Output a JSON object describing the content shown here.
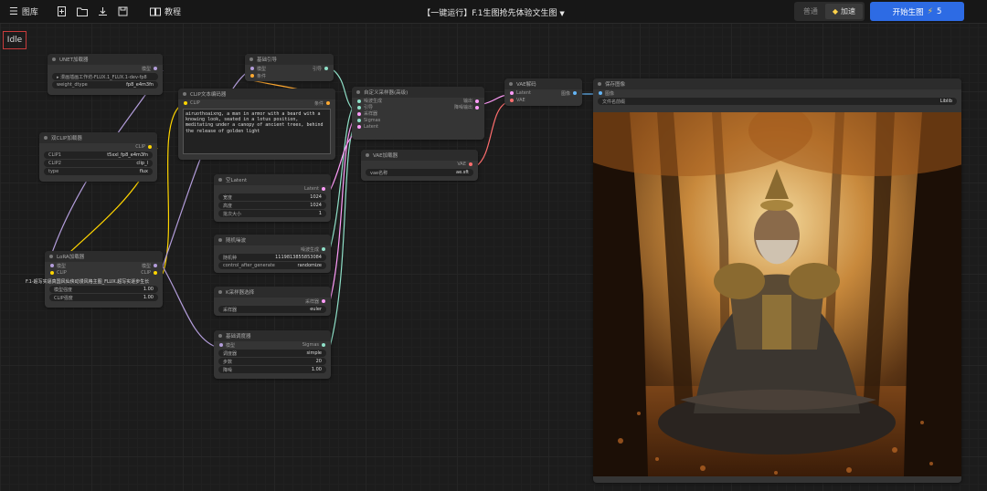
{
  "topbar": {
    "gallery_label": "图库",
    "tutorial_label": "教程",
    "workflow_title": "【一键运行】F.1生图抢先体验文生图",
    "mode_normal": "普通",
    "mode_boost": "加速",
    "run_label": "开始生图",
    "run_cost": "5"
  },
  "status": "Idle",
  "nodes": {
    "unet": {
      "title": "UNET加载器",
      "out_model": "模型",
      "w1_label": "▸ 漫画插画工作坊-FLUX.1_FLUX.1-dev-fp8",
      "w2_label": "weight_dtype",
      "w2_value": "fp8_e4m3fn"
    },
    "dualclip": {
      "title": "双CLIP加载器",
      "out_clip": "CLIP",
      "w1_label": "CLIP1",
      "w1_value": "t5xxl_fp8_e4m3fn",
      "w2_label": "CLIP2",
      "w2_value": "clip_l",
      "w3_label": "type",
      "w3_value": "flux"
    },
    "lora": {
      "title": "LoRA加载器",
      "in_model": "模型",
      "in_clip": "CLIP",
      "out_model": "模型",
      "out_clip": "CLIP",
      "w1_value": "F.1-超写实逼真国风仙侠动漫风格主图_FLUX.超写实逐步生长-V1",
      "w2_label": "模型强度",
      "w2_value": "1.00",
      "w3_label": "CLIP强度",
      "w3_value": "1.00"
    },
    "guider": {
      "title": "基础引导",
      "in_model": "模型",
      "in_cond": "条件",
      "out_guider": "引导"
    },
    "clip_text": {
      "title": "CLIP文本编码器",
      "in_clip": "CLIP",
      "out_cond": "条件",
      "text": "airuothoaixng, a man in armor with a beard with a knowing look, seated in a lotus position, meditating under a canopy of ancient trees, behind the release of golden light"
    },
    "sampler_adv": {
      "title": "自定义采样器(高级)",
      "in1": "噪波生成",
      "in2": "引导",
      "in3": "采样器",
      "in4": "Sigmas",
      "in5": "Latent",
      "out1": "输出",
      "out2": "降噪输出"
    },
    "vae_decode": {
      "title": "VAE解码",
      "in1": "Latent",
      "in2": "VAE",
      "out1": "图像"
    },
    "vae_loader": {
      "title": "VAE加载器",
      "out": "VAE",
      "w1_label": "vae名称",
      "w1_value": "ae.sft"
    },
    "empty_latent": {
      "title": "空Latent",
      "out": "Latent",
      "w1_label": "宽度",
      "w1_value": "1024",
      "w2_label": "高度",
      "w2_value": "1024",
      "w3_label": "批次大小",
      "w3_value": "1"
    },
    "noise": {
      "title": "随机噪波",
      "out": "噪波生成",
      "w1_label": "随机种",
      "w1_value": "1119813855853084",
      "w2_label": "control_after_generate",
      "w2_value": "randomize"
    },
    "ksampler_select": {
      "title": "K采样器选择",
      "out": "采样器",
      "w1_label": "采样器",
      "w1_value": "euler"
    },
    "scheduler": {
      "title": "基础调度器",
      "in_model": "模型",
      "out": "Sigmas",
      "w1_label": "调度器",
      "w1_value": "simple",
      "w2_label": "步数",
      "w2_value": "20",
      "w3_label": "降噪",
      "w3_value": "1.00"
    },
    "save": {
      "title": "保存图像",
      "in_image": "图像",
      "w1_label": "文件名前缀",
      "w1_value": "Liblib"
    }
  },
  "colors": {
    "accent": "#2d6be4",
    "idle_border": "#c83c3c",
    "link_model": "#b39ddb",
    "link_clip": "#ffd500",
    "link_latent": "#ff9cf9",
    "link_vae": "#ff6e6e",
    "link_image": "#64b5f6",
    "link_cond": "#ffa931",
    "link_misc": "#8fe0c8"
  },
  "icons": [
    "layers-icon",
    "new-file-icon",
    "folder-icon",
    "download-icon",
    "save-icon",
    "book-icon",
    "chevron-down-icon",
    "diamond-icon",
    "bolt-icon"
  ]
}
